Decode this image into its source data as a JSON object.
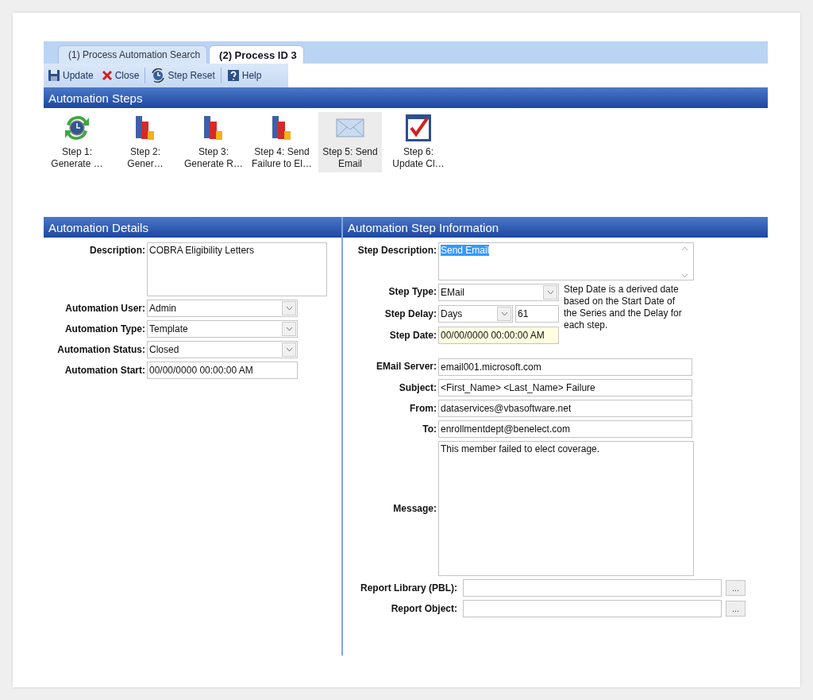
{
  "tabs": [
    {
      "label": "(1) Process Automation Search",
      "selected": false
    },
    {
      "label": "(2) Process ID 3",
      "selected": true
    }
  ],
  "toolbar": [
    {
      "label": "Update",
      "kind": "save"
    },
    {
      "label": "Close",
      "kind": "close"
    },
    {
      "label": "Step Reset",
      "kind": "reset"
    },
    {
      "label": "Help",
      "kind": "help"
    }
  ],
  "steps_section": {
    "title": "Automation Steps",
    "steps": [
      {
        "lines": [
          "Step 1:",
          "Generate …"
        ],
        "kind": "clock",
        "selected": false
      },
      {
        "lines": [
          "Step 2:",
          "Gener…"
        ],
        "kind": "chart",
        "selected": false
      },
      {
        "lines": [
          "Step 3:",
          "Generate R…"
        ],
        "kind": "chart",
        "selected": false
      },
      {
        "lines": [
          "Step 4: Send",
          "Failure to El…"
        ],
        "kind": "chart",
        "selected": false
      },
      {
        "lines": [
          "Step 5: Send",
          "Email"
        ],
        "kind": "mail",
        "selected": true
      },
      {
        "lines": [
          "Step 6:",
          "Update Cl…"
        ],
        "kind": "check",
        "selected": false
      }
    ]
  },
  "details": {
    "title": "Automation Details",
    "fields": [
      {
        "label": "Description:",
        "kind": "textarea",
        "value": "COBRA Eligibility Letters"
      },
      {
        "label": "Automation User:",
        "kind": "select",
        "value": "Admin"
      },
      {
        "label": "Automation Type:",
        "kind": "select",
        "value": "Template"
      },
      {
        "label": "Automation Status:",
        "kind": "select",
        "value": "Closed"
      },
      {
        "label": "Automation Start:",
        "kind": "text",
        "value": "00/00/0000 00:00:00 AM"
      }
    ]
  },
  "step_info": {
    "title": "Automation Step Information",
    "step_description": {
      "label": "Step Description:",
      "value": "Send Email",
      "value_selected": true
    },
    "step_type": {
      "label": "Step Type:",
      "value": "EMail"
    },
    "step_delay": {
      "label": "Step Delay:",
      "unit": "Days",
      "value": "61"
    },
    "step_date": {
      "label": "Step Date:",
      "value": "00/00/0000 00:00:00 AM"
    },
    "note": "Step Date is a derived date based on the Start Date of the Series and the Delay for each step.",
    "email_fields": [
      {
        "label": "EMail Server:",
        "value": "email001.microsoft.com"
      },
      {
        "label": "Subject:",
        "value": "<First_Name> <Last_Name> Failure"
      },
      {
        "label": "From:",
        "value": "dataservices@vbasoftware.net"
      },
      {
        "label": "To:",
        "value": "enrollmentdept@benelect.com"
      }
    ],
    "message": {
      "label": "Message:",
      "value": "This member failed to elect coverage."
    },
    "report_fields": [
      {
        "label": "Report Library (PBL):",
        "button": "..."
      },
      {
        "label": "Report Object:",
        "button": "..."
      }
    ]
  }
}
